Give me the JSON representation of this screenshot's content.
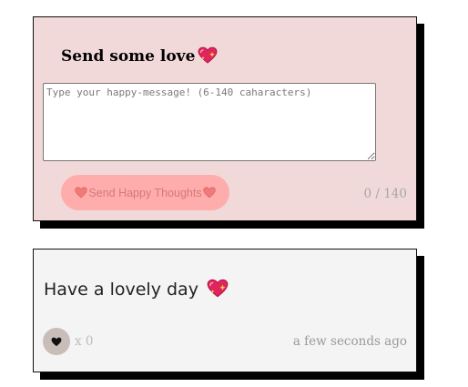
{
  "compose": {
    "title": "Send some love",
    "title_icon": "sparkling-heart-icon",
    "input_placeholder": "Type your happy-message! (6-140 caharacters)",
    "input_value": "",
    "send_label": "Send Happy Thoughts",
    "send_icon": "heart-icon",
    "char_count": "0",
    "char_separator": " / ",
    "char_max": "140"
  },
  "posts": [
    {
      "message": "Have a lovely day",
      "message_icon": "sparkling-heart-icon",
      "like_icon": "black-heart-icon",
      "like_prefix": "x ",
      "likes": "0",
      "timestamp": "a few seconds ago"
    }
  ],
  "colors": {
    "compose_background": "#f2d9d9",
    "send_button": "#ffacac",
    "send_text": "#d87878",
    "post_background": "#f4f4f4",
    "like_button": "#c8bdb9"
  }
}
